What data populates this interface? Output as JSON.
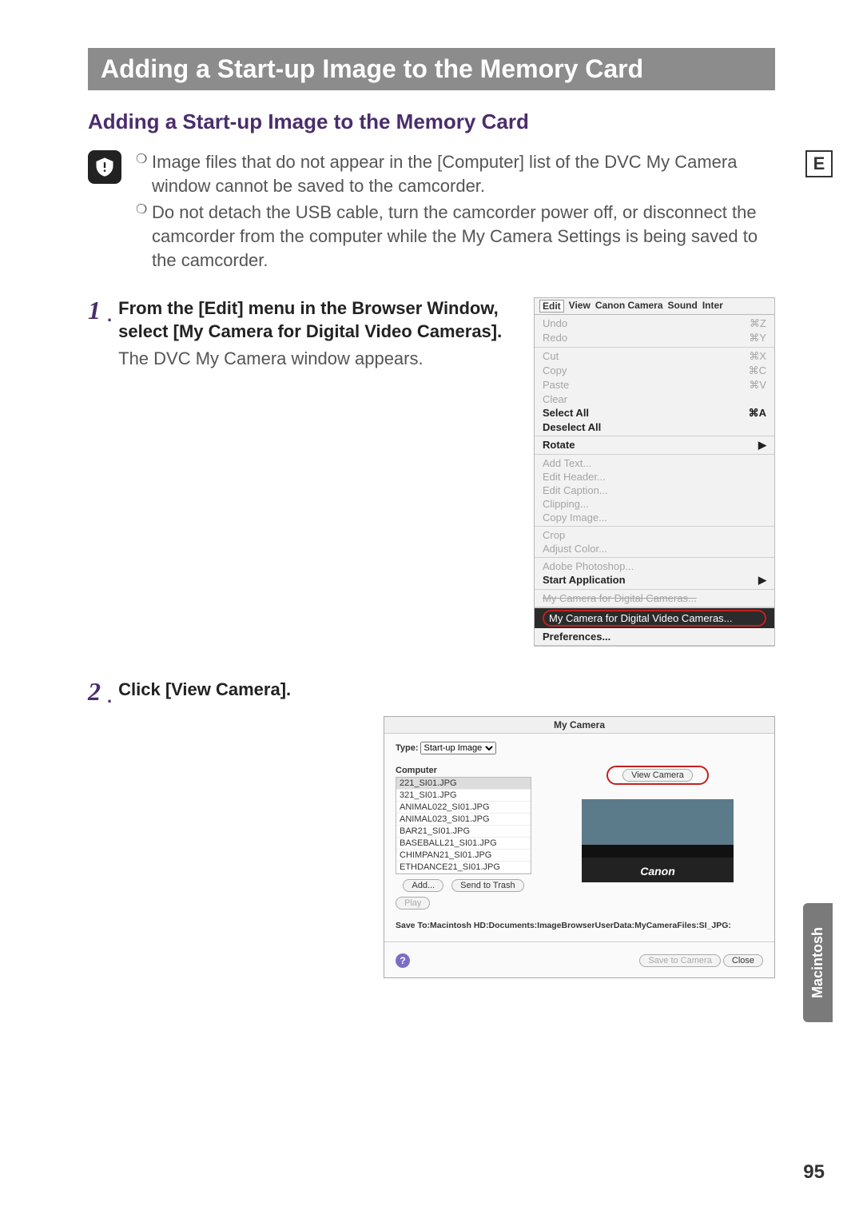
{
  "header": {
    "title": "Adding a Start-up Image to the Memory Card"
  },
  "subtitle": "Adding a Start-up Image to the Memory Card",
  "lang_marker": "E",
  "note": {
    "b1": "Image files that do not appear in the [Computer] list of the DVC My Camera window cannot be saved to the camcorder.",
    "b2": "Do not detach the USB cable, turn the camcorder power off, or disconnect the camcorder from the computer while the My Camera Settings is being saved to the camcorder."
  },
  "steps": {
    "s1": {
      "num": "1",
      "title": "From the [Edit] menu in the Browser Window, select [My Camera for Digital Video Cameras].",
      "desc": "The DVC My Camera window appears."
    },
    "s2": {
      "num": "2",
      "title": "Click [View Camera]."
    }
  },
  "edit_menu": {
    "bar": [
      "Edit",
      "View",
      "Canon Camera",
      "Sound",
      "Inter"
    ],
    "groups": [
      [
        {
          "label": "Undo",
          "sc": "⌘Z",
          "dis": true
        },
        {
          "label": "Redo",
          "sc": "⌘Y",
          "dis": true
        }
      ],
      [
        {
          "label": "Cut",
          "sc": "⌘X",
          "dis": true
        },
        {
          "label": "Copy",
          "sc": "⌘C",
          "dis": true
        },
        {
          "label": "Paste",
          "sc": "⌘V",
          "dis": true
        },
        {
          "label": "Clear",
          "sc": "",
          "dis": true
        },
        {
          "label": "Select All",
          "sc": "⌘A",
          "bold": true
        },
        {
          "label": "Deselect All",
          "sc": "",
          "bold": true
        }
      ],
      [
        {
          "label": "Rotate",
          "sc": "",
          "arrow": true,
          "bold": true
        }
      ],
      [
        {
          "label": "Add Text...",
          "dis": true
        },
        {
          "label": "Edit Header...",
          "dis": true
        },
        {
          "label": "Edit Caption...",
          "dis": true
        },
        {
          "label": "Clipping...",
          "dis": true
        },
        {
          "label": "Copy Image...",
          "dis": true
        }
      ],
      [
        {
          "label": "Crop",
          "dis": true
        },
        {
          "label": "Adjust Color...",
          "dis": true
        }
      ],
      [
        {
          "label": "Adobe Photoshop...",
          "dis": true
        },
        {
          "label": "Start Application",
          "arrow": true,
          "bold": true
        }
      ]
    ],
    "strike_item": "My Camera for Digital Cameras...",
    "highlight": "My Camera for Digital Video Cameras...",
    "prefs": "Preferences..."
  },
  "mycam": {
    "title": "My Camera",
    "type_label": "Type:",
    "type_value": "Start-up Image",
    "list_header": "Computer",
    "files": [
      "221_SI01.JPG",
      "321_SI01.JPG",
      "ANIMAL022_SI01.JPG",
      "ANIMAL023_SI01.JPG",
      "BAR21_SI01.JPG",
      "BASEBALL21_SI01.JPG",
      "CHIMPAN21_SI01.JPG",
      "ETHDANCE21_SI01.JPG"
    ],
    "btn_add": "Add...",
    "btn_trash": "Send to Trash",
    "btn_play": "Play",
    "btn_view": "View Camera",
    "preview_brand": "Canon",
    "save_path": "Save To:Macintosh HD:Documents:ImageBrowserUserData:MyCameraFiles:SI_JPG:",
    "btn_savecam": "Save to Camera",
    "btn_close": "Close"
  },
  "sidetab": "Macintosh",
  "page_number": "95"
}
